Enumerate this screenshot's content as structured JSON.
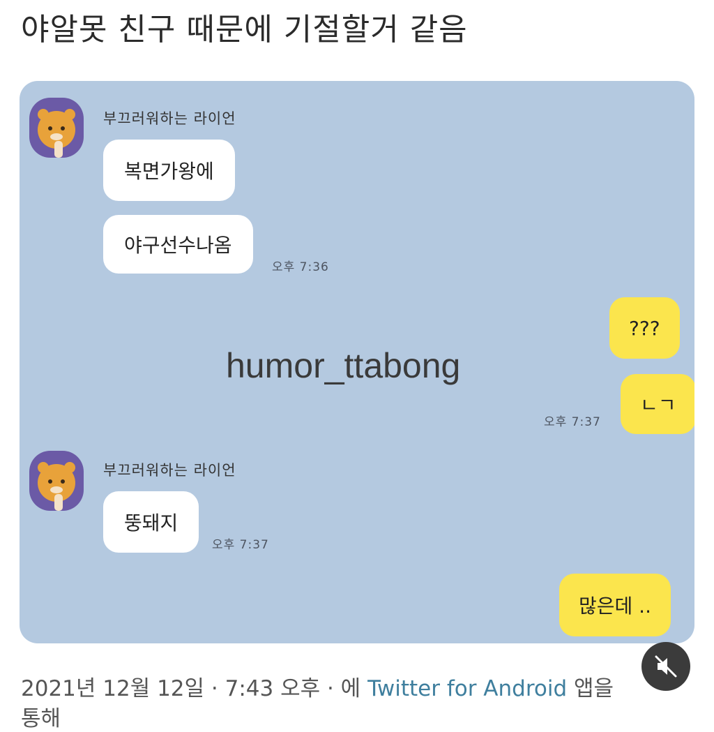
{
  "post": {
    "title": "야알못 친구 때문에 기절할거 같음"
  },
  "chat": {
    "messages": [
      {
        "sender": "부끄러워하는 라이언",
        "text": "복면가왕에"
      },
      {
        "text": "야구선수나옴",
        "time": "오후 7:36"
      },
      {
        "text": "???"
      },
      {
        "text": "ㄴㄱ",
        "time": "오후 7:37"
      },
      {
        "sender": "부끄러워하는 라이언",
        "text": "뚱돼지",
        "time": "오후 7:37"
      },
      {
        "text": "많은데 .."
      }
    ],
    "watermark": "humor_ttabong",
    "avatar_icon": "ryan-character-icon",
    "colors": {
      "background": "#b4c9e0",
      "mine": "#fbe54d",
      "theirs": "#ffffff"
    }
  },
  "footer": {
    "date": "2021년 12월 12일 · 7:43 오후 · 에",
    "app": "Twitter for Android",
    "suffix": "앱을",
    "line2": "통해"
  },
  "controls": {
    "mute_icon": "speaker-muted-icon"
  }
}
